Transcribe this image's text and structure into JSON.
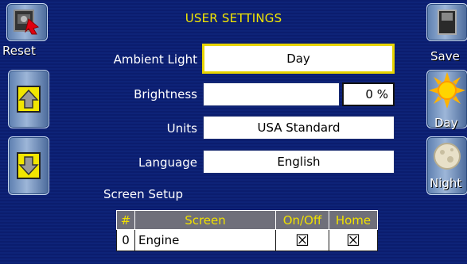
{
  "header": {
    "title": "USER SETTINGS"
  },
  "left_buttons": {
    "reset_label": "Reset",
    "up_icon": "arrow-up-icon",
    "down_icon": "arrow-down-icon"
  },
  "right_buttons": {
    "save_label": "Save",
    "day_label": "Day",
    "night_label": "Night"
  },
  "settings": {
    "ambient_light": {
      "label": "Ambient Light",
      "value": "Day"
    },
    "brightness": {
      "label": "Brightness",
      "value": "0 %",
      "level_percent": 0
    },
    "units": {
      "label": "Units",
      "value": "USA Standard"
    },
    "language": {
      "label": "Language",
      "value": "English"
    }
  },
  "screen_setup": {
    "heading": "Screen Setup",
    "columns": [
      "#",
      "Screen",
      "On/Off",
      "Home"
    ],
    "rows": [
      {
        "num": "0",
        "screen": "Engine",
        "on_off": "☒",
        "home": "☒"
      }
    ]
  },
  "colors": {
    "accent": "#f2e600",
    "background": "#0b1d6e",
    "header_cell": "#6f6f7a"
  }
}
